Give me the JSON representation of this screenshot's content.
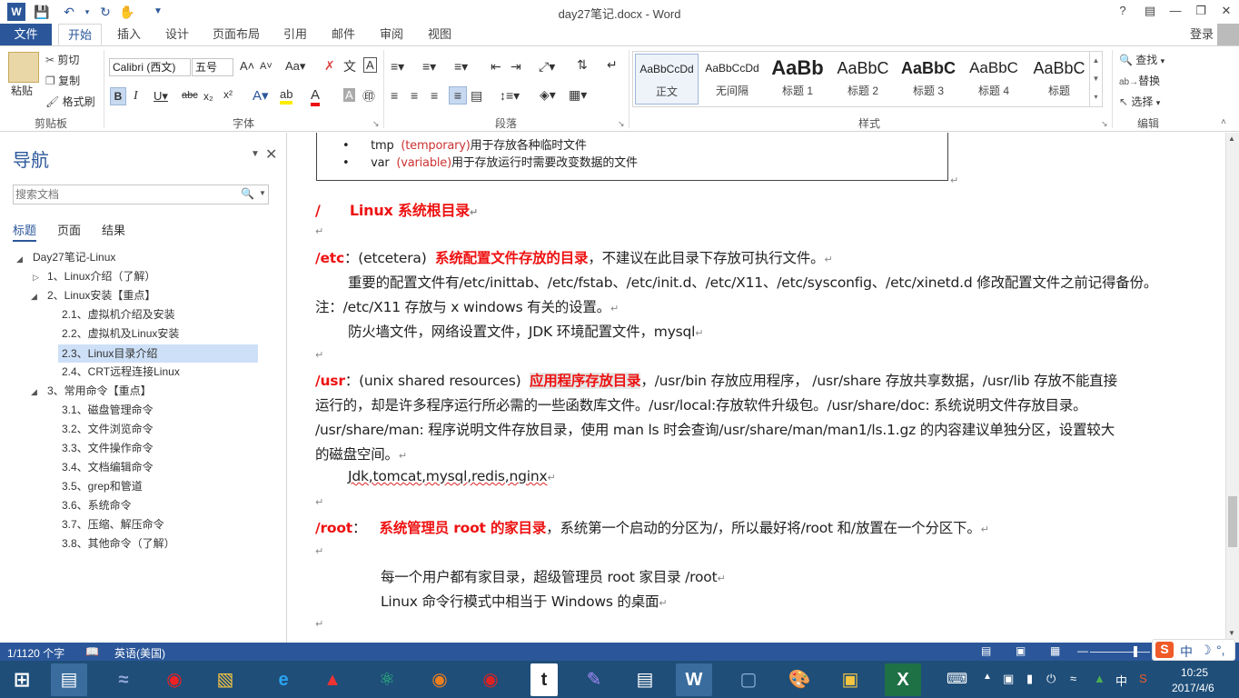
{
  "titlebar": {
    "doc_title": "day27笔记.docx - Word",
    "help": "?",
    "login": "登录"
  },
  "tabs": [
    "文件",
    "开始",
    "插入",
    "设计",
    "页面布局",
    "引用",
    "邮件",
    "审阅",
    "视图"
  ],
  "ribbon": {
    "clipboard": {
      "paste": "粘贴",
      "cut": "剪切",
      "copy": "复制",
      "format_painter": "格式刷",
      "group": "剪贴板"
    },
    "font": {
      "family": "Calibri (西文)",
      "size": "五号",
      "group": "字体"
    },
    "paragraph": {
      "group": "段落"
    },
    "styles": {
      "group": "样式",
      "items": [
        {
          "preview": "AaBbCcDd",
          "name": "正文"
        },
        {
          "preview": "AaBbCcDd",
          "name": "无间隔"
        },
        {
          "preview": "AaBb",
          "name": "标题 1"
        },
        {
          "preview": "AaBbC",
          "name": "标题 2"
        },
        {
          "preview": "AaBbC",
          "name": "标题 3"
        },
        {
          "preview": "AaBbC",
          "name": "标题 4"
        },
        {
          "preview": "AaBbC",
          "name": "标题"
        }
      ]
    },
    "editing": {
      "find": "查找",
      "replace": "替换",
      "select": "选择",
      "group": "编辑"
    }
  },
  "nav": {
    "title": "导航",
    "search_placeholder": "搜索文档",
    "tabs": [
      "标题",
      "页面",
      "结果"
    ],
    "tree": [
      {
        "label": "Day27笔记-Linux"
      },
      {
        "label": "1、Linux介绍（了解）"
      },
      {
        "label": "2、Linux安装【重点】"
      },
      {
        "label": "2.1、虚拟机介绍及安装"
      },
      {
        "label": "2.2、虚拟机及Linux安装"
      },
      {
        "label": "2.3、Linux目录介绍"
      },
      {
        "label": "2.4、CRT远程连接Linux"
      },
      {
        "label": "3、常用命令【重点】"
      },
      {
        "label": "3.1、磁盘管理命令"
      },
      {
        "label": "3.2、文件浏览命令"
      },
      {
        "label": "3.3、文件操作命令"
      },
      {
        "label": "3.4、文档编辑命令"
      },
      {
        "label": "3.5、grep和管道"
      },
      {
        "label": "3.6、系统命令"
      },
      {
        "label": "3.7、压缩、解压命令"
      },
      {
        "label": "3.8、其他命令（了解）"
      }
    ]
  },
  "doc": {
    "box_line1_name": "tmp",
    "box_line1_paren": "(temporary)",
    "box_line1_text": "用于存放各种临时文件",
    "box_line2_name": "var",
    "box_line2_paren": "(variable)",
    "box_line2_text": "用于存放运行时需要改变数据的文件",
    "root_heading_slash": "/",
    "root_heading": "Linux 系统根目录",
    "etc_label": "/etc",
    "etc_paren": "：(etcetera)",
    "etc_red": "系统配置文件存放的目录",
    "etc_rest": "，不建议在此目录下存放可执行文件。",
    "etc_line2": "重要的配置文件有/etc/inittab、/etc/fstab、/etc/init.d、/etc/X11、/etc/sysconfig、/etc/xinetd.d 修改配置文件之前记得备份。",
    "etc_line3": "注：/etc/X11 存放与 x windows 有关的设置。",
    "etc_line4": "防火墙文件，网络设置文件，JDK 环境配置文件，mysql",
    "usr_label": "/usr",
    "usr_paren": "：(unix shared resources)",
    "usr_red": "应用程序存放目录",
    "usr_rest": "，/usr/bin  存放应用程序，  /usr/share  存放共享数据，/usr/lib  存放不能直接",
    "usr_line2": "运行的，却是许多程序运行所必需的一些函数库文件。/usr/local:存放软件升级包。/usr/share/doc: 系统说明文件存放目录。",
    "usr_line3": "/usr/share/man: 程序说明文件存放目录，使用  man ls 时会查询/usr/share/man/man1/ls.1.gz 的内容建议单独分区，设置较大",
    "usr_line4": "的磁盘空间。",
    "usr_line5": "Jdk,tomcat,mysql,redis,nginx",
    "rootdir_label": "/root",
    "rootdir_colon": "：",
    "rootdir_red": "系统管理员 root 的家目录",
    "rootdir_rest": "，系统第一个启动的分区为/，所以最好将/root 和/放置在一个分区下。",
    "home_line1": "每一个用户都有家目录，超级管理员 root 家目录    /root",
    "home_line2": "Linux 命令行模式中相当于 Windows 的桌面"
  },
  "status": {
    "page": "1/1120 个字",
    "lang": "英语(美国)"
  },
  "taskbar": {
    "time": "10:25",
    "date": "2017/4/6",
    "ime": "中"
  },
  "colors": {
    "accent": "#2b579a",
    "heading_red": "#e11111",
    "taskbar": "#1f4e79"
  }
}
